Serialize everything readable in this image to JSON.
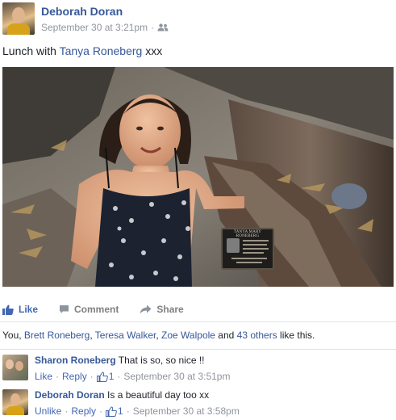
{
  "post": {
    "author": "Deborah Doran",
    "timestamp": "September 30 at 3:21pm",
    "separator": "·",
    "privacy_icon": "friends-icon",
    "text_prefix": "Lunch with ",
    "tagged_person": "Tanya Roneberg",
    "text_suffix": " xxx",
    "plaque_title": "TANYA MARY RONEBERG"
  },
  "actions": {
    "like": "Like",
    "comment": "Comment",
    "share": "Share"
  },
  "likes": {
    "prefix": "You, ",
    "names": [
      "Brett Roneberg",
      "Teresa Walker",
      "Zoe Walpole"
    ],
    "sep1": ", ",
    "sep2": ", ",
    "and": " and ",
    "others": "43 others",
    "suffix": " like this."
  },
  "comments": [
    {
      "author": "Sharon Roneberg",
      "text": " That is so, so nice !!",
      "action1": "Like",
      "action2": "Reply",
      "like_count": "1",
      "timestamp": "September 30 at 3:51pm"
    },
    {
      "author": "Deborah Doran",
      "text": " Is a beautiful day too xx",
      "action1": "Unlike",
      "action2": "Reply",
      "like_count": "1",
      "timestamp": "September 30 at 3:58pm"
    }
  ],
  "dot": "·",
  "colors": {
    "link": "#365899",
    "like_blue": "#4267b2",
    "meta_gray": "#90949c"
  }
}
